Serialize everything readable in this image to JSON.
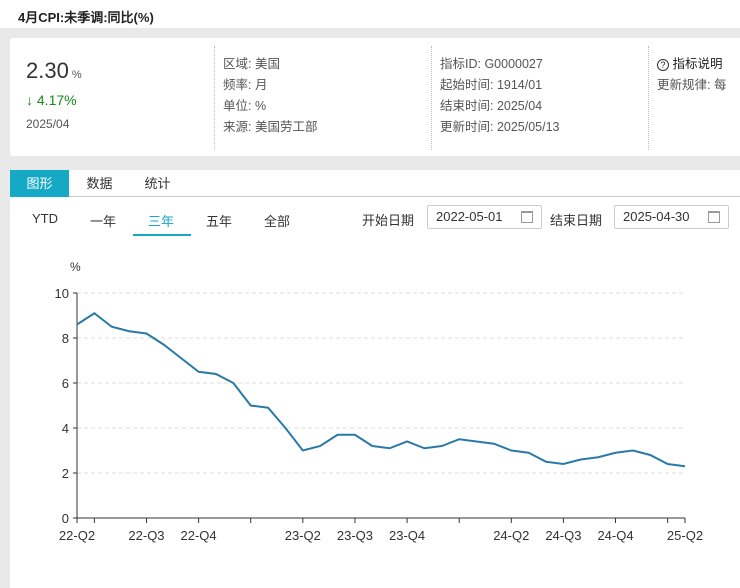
{
  "title": "4月CPI:未季调:同比(%)",
  "summary": {
    "value": "2.30",
    "unit": "%",
    "change": "↓ 4.17%",
    "date": "2025/04"
  },
  "meta1": [
    "区域: 美国",
    "频率: 月",
    "单位: %",
    "来源: 美国劳工部"
  ],
  "meta2": [
    "指标ID: G0000027",
    "起始时间: 1914/01",
    "结束时间: 2025/04",
    "更新时间: 2025/05/13"
  ],
  "meta3": {
    "help_label": "指标说明",
    "update_rule": "更新规律: 每"
  },
  "tabs": [
    "图形",
    "数据",
    "统计"
  ],
  "active_tab": "图形",
  "ranges": [
    "YTD",
    "一年",
    "三年",
    "五年",
    "全部"
  ],
  "active_range": "三年",
  "start_label": "开始日期",
  "start_date": "2022-05-01",
  "end_label": "结束日期",
  "end_date": "2025-04-30",
  "colors": {
    "accent": "#16a9c5",
    "line": "#2a7aa8",
    "down": "#1a8a1a"
  },
  "chart_data": {
    "type": "line",
    "ylabel": "%",
    "ylim": [
      0,
      10
    ],
    "yticks": [
      0,
      2,
      4,
      6,
      8,
      10
    ],
    "grid": true,
    "x": [
      "2022-05",
      "2022-06",
      "2022-07",
      "2022-08",
      "2022-09",
      "2022-10",
      "2022-11",
      "2022-12",
      "2023-01",
      "2023-02",
      "2023-03",
      "2023-04",
      "2023-05",
      "2023-06",
      "2023-07",
      "2023-08",
      "2023-09",
      "2023-10",
      "2023-11",
      "2023-12",
      "2024-01",
      "2024-02",
      "2024-03",
      "2024-04",
      "2024-05",
      "2024-06",
      "2024-07",
      "2024-08",
      "2024-09",
      "2024-10",
      "2024-11",
      "2024-12",
      "2025-01",
      "2025-02",
      "2025-03",
      "2025-04"
    ],
    "values": [
      8.6,
      9.1,
      8.5,
      8.3,
      8.2,
      7.7,
      7.1,
      6.5,
      6.4,
      6.0,
      5.0,
      4.9,
      4.0,
      3.0,
      3.2,
      3.7,
      3.7,
      3.2,
      3.1,
      3.4,
      3.1,
      3.2,
      3.5,
      3.4,
      3.3,
      3.0,
      2.9,
      2.5,
      2.4,
      2.6,
      2.7,
      2.9,
      3.0,
      2.8,
      2.4,
      2.3
    ],
    "xticks": [
      {
        "at": "2022-05",
        "label": "22-Q2"
      },
      {
        "at": "2022-06",
        "label": ""
      },
      {
        "at": "2022-09",
        "label": "22-Q3"
      },
      {
        "at": "2022-12",
        "label": "22-Q4"
      },
      {
        "at": "2023-03",
        "label": ""
      },
      {
        "at": "2023-06",
        "label": "23-Q2"
      },
      {
        "at": "2023-09",
        "label": "23-Q3"
      },
      {
        "at": "2023-12",
        "label": "23-Q4"
      },
      {
        "at": "2024-03",
        "label": ""
      },
      {
        "at": "2024-06",
        "label": "24-Q2"
      },
      {
        "at": "2024-09",
        "label": "24-Q3"
      },
      {
        "at": "2024-12",
        "label": "24-Q4"
      },
      {
        "at": "2025-03",
        "label": ""
      },
      {
        "at": "2025-04",
        "label": "25-Q2"
      }
    ]
  }
}
